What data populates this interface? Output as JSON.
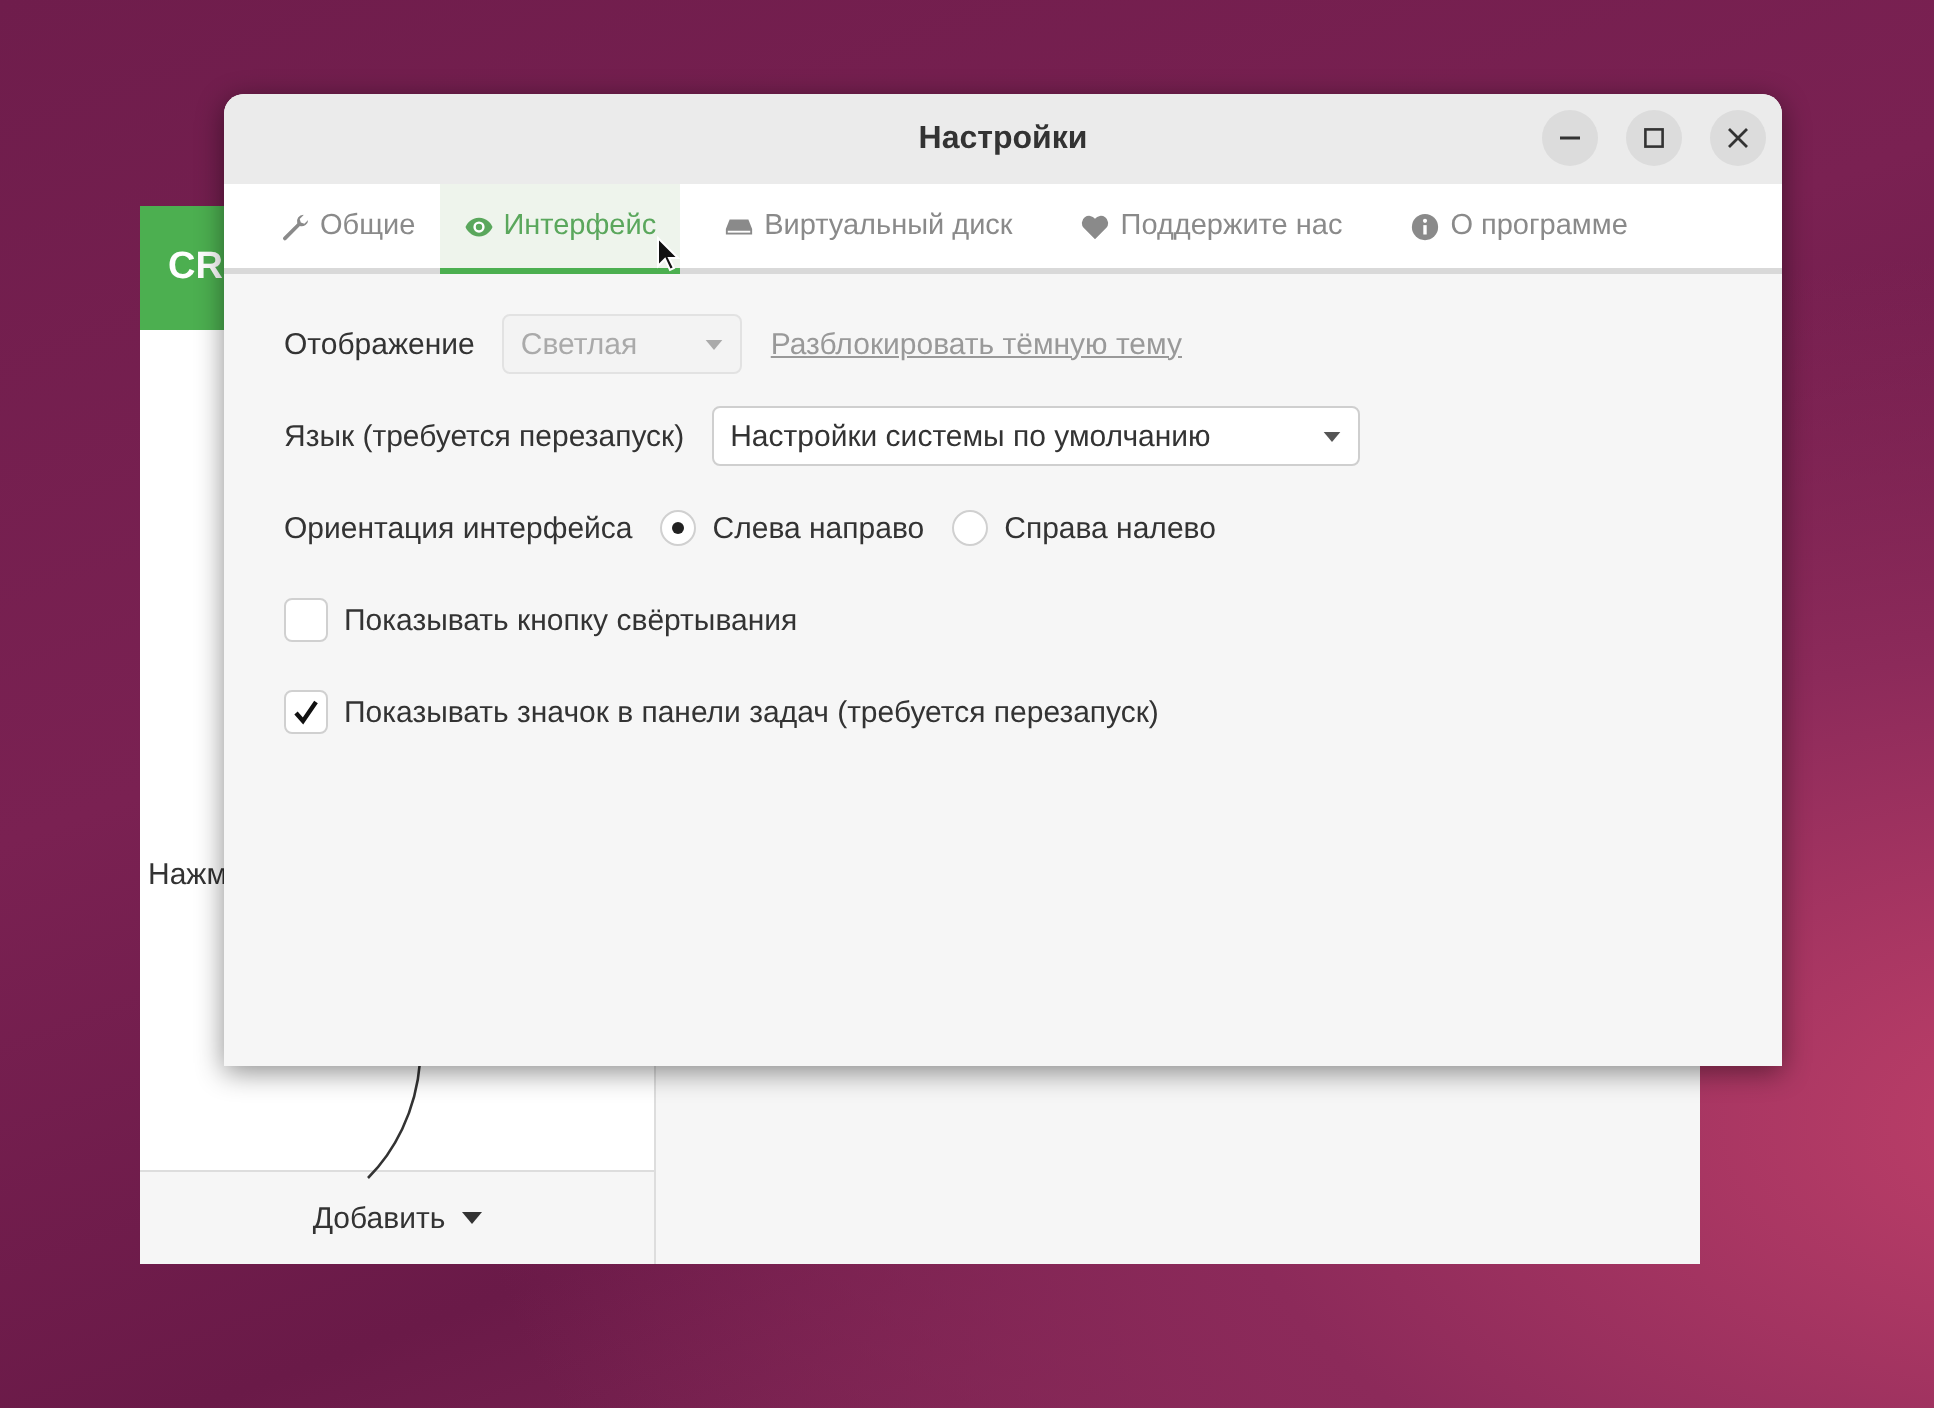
{
  "background_window": {
    "header_text": "CR",
    "sidebar_text": "Нажм",
    "add_button": {
      "label": "Добавить"
    }
  },
  "dialog": {
    "title": "Настройки",
    "tabs": [
      {
        "label": "Общие",
        "selected": false
      },
      {
        "label": "Интерфейс",
        "selected": true
      },
      {
        "label": "Виртуальный диск",
        "selected": false
      },
      {
        "label": "Поддержите нас",
        "selected": false
      },
      {
        "label": "О программе",
        "selected": false
      }
    ],
    "display": {
      "label": "Отображение",
      "select": {
        "value": "Светлая",
        "disabled": true
      },
      "link": "Разблокировать тёмную тему"
    },
    "language": {
      "label": "Язык (требуется перезапуск)",
      "select": {
        "value": "Настройки системы по умолчанию",
        "disabled": false
      }
    },
    "orientation": {
      "label": "Ориентация интерфейса",
      "options": [
        {
          "label": "Слева направо",
          "selected": true
        },
        {
          "label": "Справа налево",
          "selected": false
        }
      ]
    },
    "checkboxes": [
      {
        "label": "Показывать кнопку свёртывания",
        "checked": false
      },
      {
        "label": "Показывать значок в панели задач (требуется перезапуск)",
        "checked": true
      }
    ]
  }
}
